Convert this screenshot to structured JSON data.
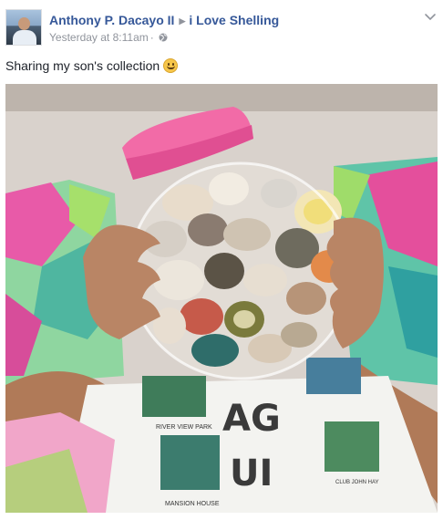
{
  "post": {
    "author": "Anthony P. Dacayo II",
    "group": "i Love Shelling",
    "timestamp": "Yesterday at 8:11am",
    "separator": "·",
    "privacy_icon": "globe-icon",
    "menu_icon": "chevron-down-icon",
    "text": "Sharing my son's collection",
    "emoji": "smiley-emoji-icon"
  },
  "photo": {
    "shirt_text": {
      "top_banner": "RIVER VIEW PARK",
      "bottom_banner": "MANSION HOUSE",
      "right_banner": "CLUB JOHN HAY",
      "letters_left": "AG",
      "letters_right": "UI"
    }
  }
}
